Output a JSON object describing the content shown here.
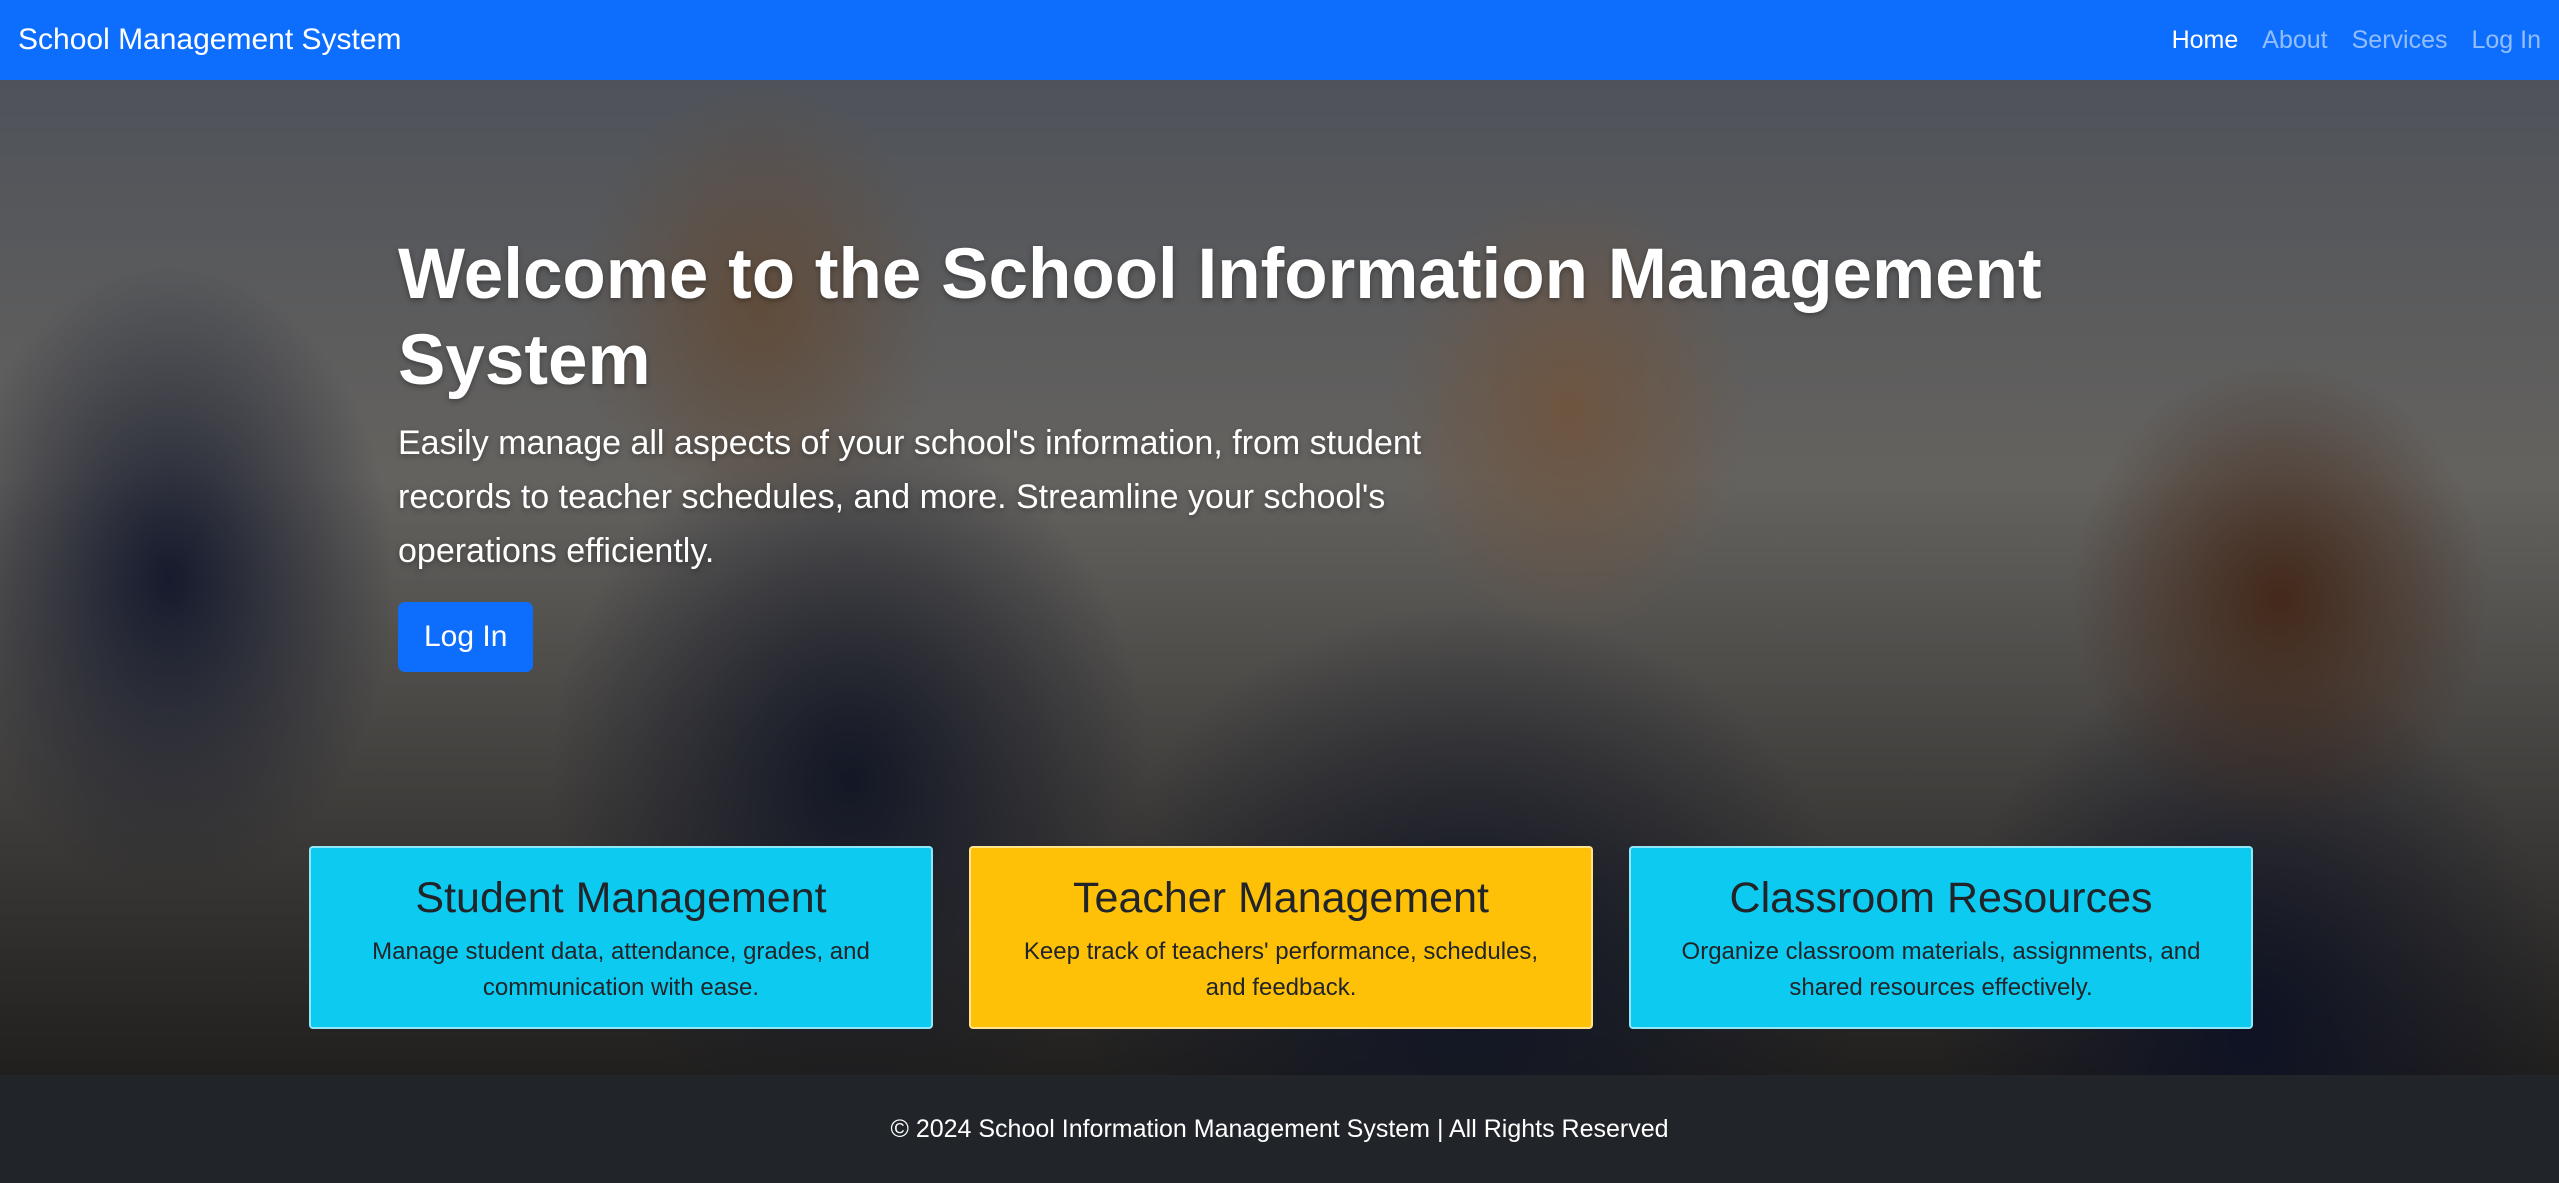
{
  "navbar": {
    "brand": "School Management System",
    "links": [
      "Home",
      "About",
      "Services",
      "Log In"
    ],
    "active": "Home",
    "color": "#0d6efd"
  },
  "hero": {
    "title": "Welcome to the School Information Management System",
    "subtitle": "Easily manage all aspects of your school's information, from student records to teacher schedules, and more. Streamline your school's operations efficiently.",
    "button_label": "Log In",
    "background": "photo of smiling students in navy blazers and striped ties in a classroom"
  },
  "cards": [
    {
      "title": "Student Management",
      "text": "Manage student data, attendance, grades, and communication with ease.",
      "color": "#0dcaf0"
    },
    {
      "title": "Teacher Management",
      "text": "Keep track of teachers' performance, schedules, and feedback.",
      "color": "#ffc107"
    },
    {
      "title": "Classroom Resources",
      "text": "Organize classroom materials, assignments, and shared resources effectively.",
      "color": "#0dcaf0"
    }
  ],
  "footer": {
    "text": "© 2024 School Information Management System | All Rights Reserved"
  }
}
